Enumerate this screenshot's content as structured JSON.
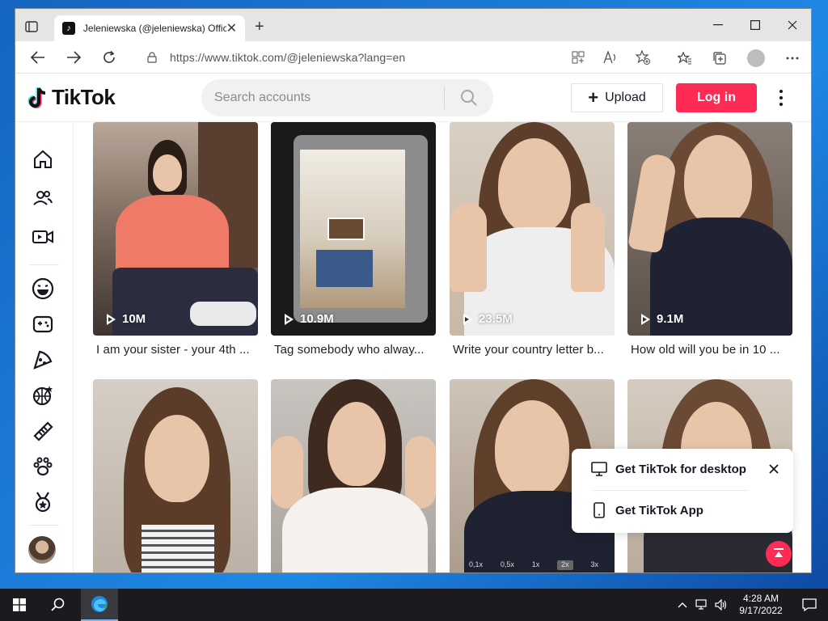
{
  "browser": {
    "tab_title": "Jeleniewska (@jeleniewska) Offic",
    "url": "https://www.tiktok.com/@jeleniewska?lang=en",
    "new_tab_glyph": "+",
    "close_glyph": "✕"
  },
  "tiktok": {
    "logo_text": "TikTok",
    "search_placeholder": "Search accounts",
    "upload_label": "Upload",
    "login_label": "Log in",
    "brand_color": "#fe2c55"
  },
  "sidebar": {
    "icons": [
      "home-icon",
      "following-icon",
      "live-icon",
      "comedy-icon",
      "gaming-icon",
      "food-icon",
      "sports-icon",
      "beauty-icon",
      "animals-icon",
      "achievement-icon"
    ]
  },
  "videos": [
    {
      "views": "10M",
      "caption": "I am your sister - your 4th ..."
    },
    {
      "views": "10.9M",
      "caption": "Tag somebody who alway..."
    },
    {
      "views": "23.5M",
      "caption": "Write your country letter b..."
    },
    {
      "views": "9.1M",
      "caption": "How old will you be in 10 ..."
    },
    {
      "views": "",
      "caption": ""
    },
    {
      "views": "",
      "caption": ""
    },
    {
      "views": "",
      "caption": ""
    },
    {
      "views": "",
      "caption": ""
    }
  ],
  "speed_options": [
    "0,1x",
    "0,5x",
    "1x",
    "2x",
    "3x"
  ],
  "popup": {
    "desktop_label": "Get TikTok for desktop",
    "app_label": "Get TikTok App"
  },
  "taskbar": {
    "time": "4:28 AM",
    "date": "9/17/2022"
  }
}
